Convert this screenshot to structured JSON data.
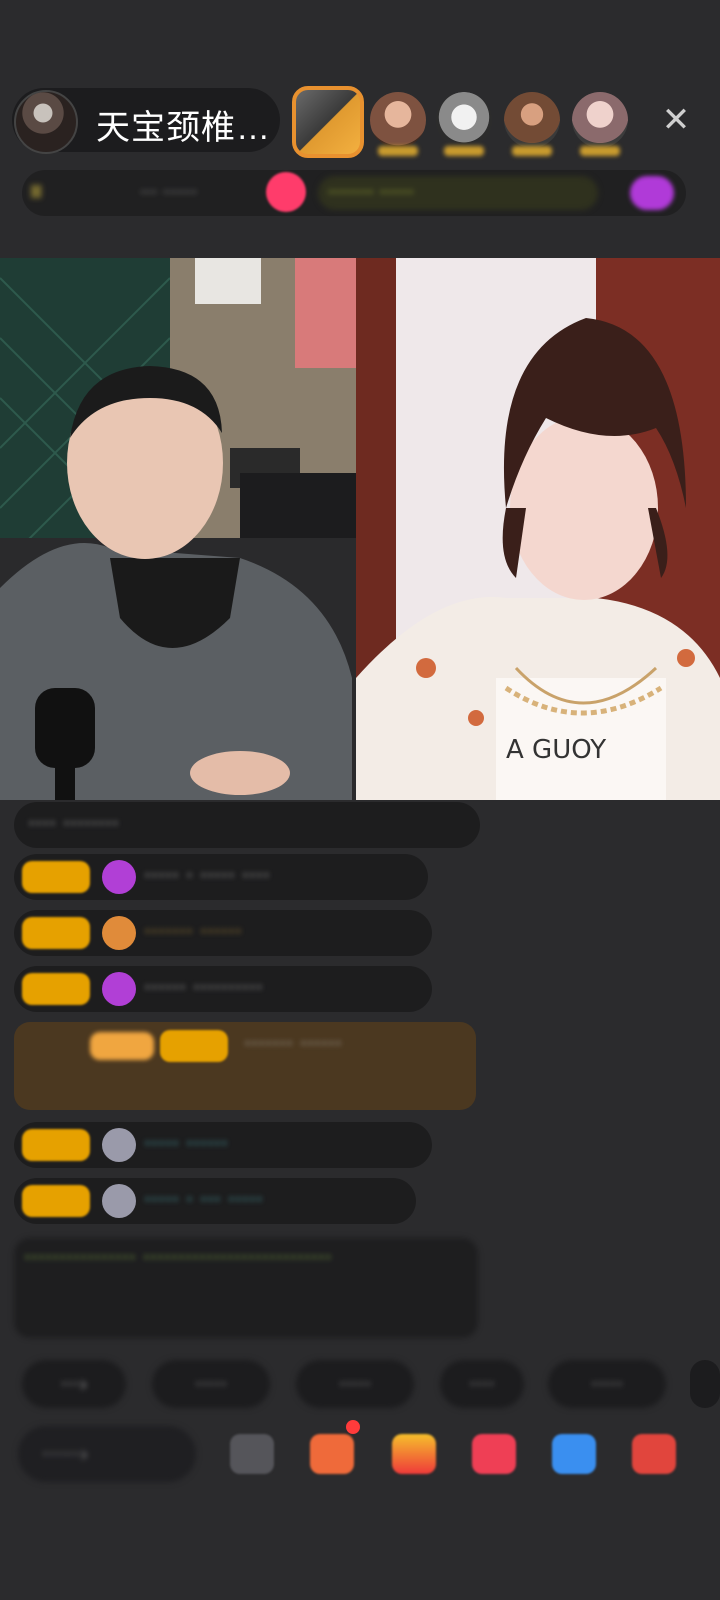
{
  "header": {
    "host_name": "天宝颈椎…",
    "audience": [
      "viewer-1",
      "viewer-2",
      "viewer-3",
      "viewer-4",
      "viewer-5"
    ],
    "close_icon": "close-icon"
  },
  "info_row": {
    "item1": "Ⅲ",
    "item2": "··· ······",
    "yellow_text": "········ ······",
    "colors": {
      "pink": "#ff3c6b",
      "yellow": "#cfe23a",
      "purple": "#b03ad8"
    }
  },
  "video": {
    "left_label": "guest-video",
    "right_label": "host-video",
    "shirt_text": "A GUOY"
  },
  "chat": [
    {
      "text": "···· ········"
    },
    {
      "text": "····· · ····· ····"
    },
    {
      "text": "······· ······"
    },
    {
      "text": "······ ··········"
    },
    {
      "text": "······· ······"
    },
    {
      "text": "····· ······"
    },
    {
      "text": "····· · ··· ·····"
    },
    {
      "text": "················ ···························"
    }
  ],
  "chips": [
    "···›",
    "·····",
    "·····",
    "····",
    "·····"
  ],
  "input_placeholder": "······›",
  "colors": {
    "background": "#2b2b2d",
    "level_badge": "#e6a100",
    "gift_highlight": "#4b3820"
  }
}
